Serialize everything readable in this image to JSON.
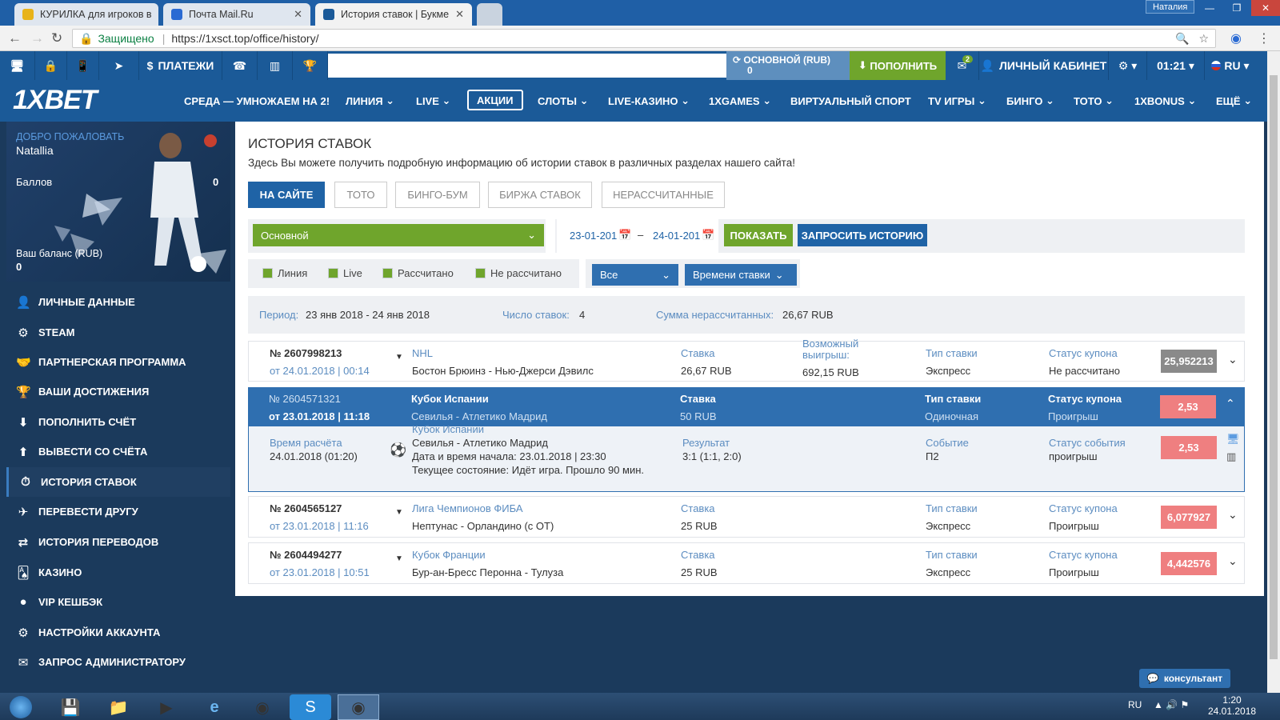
{
  "browser": {
    "tabs": [
      {
        "title": "КУРИЛКА для игроков в",
        "fav": "#e8b31a"
      },
      {
        "title": "Почта Mail.Ru",
        "fav": "#2a6ad3"
      },
      {
        "title": "История ставок | Букме",
        "fav": "#1b5a98"
      }
    ],
    "user": "Наталия",
    "secure_label": "Защищено",
    "url": "https://1xsct.top/office/history/"
  },
  "topbar": {
    "payments": "ПЛАТЕЖИ",
    "balance_label": "ОСНОВНОЙ (RUB)",
    "balance_value": "0",
    "deposit": "ПОПОЛНИТЬ",
    "messages_badge": "2",
    "cabinet": "ЛИЧНЫЙ КАБИНЕТ",
    "time": "01:21",
    "lang": "RU"
  },
  "logo": "1XBET",
  "nav": [
    "СРЕДА — УМНОЖАЕМ НА 2!",
    "ЛИНИЯ",
    "LIVE",
    "АКЦИИ",
    "СЛОТЫ",
    "LIVE-КАЗИНО",
    "1XGAMES",
    "ВИРТУАЛЬНЫЙ СПОРТ",
    "TV ИГРЫ",
    "БИНГО",
    "ТОТО",
    "1XBONUS",
    "ЕЩЁ"
  ],
  "profile": {
    "welcome": "ДОБРО ПОЖАЛОВАТЬ",
    "name": "Natallia",
    "points_label": "Баллов",
    "points": "0",
    "balance_label": "Ваш баланс (RUB)",
    "balance": "0"
  },
  "sidebar": [
    {
      "label": "ЛИЧНЫЕ ДАННЫЕ",
      "icon": "user-icon"
    },
    {
      "label": "STEAM",
      "icon": "steam-icon"
    },
    {
      "label": "ПАРТНЕРСКАЯ ПРОГРАММА",
      "icon": "handshake-icon"
    },
    {
      "label": "ВАШИ ДОСТИЖЕНИЯ",
      "icon": "trophy-icon"
    },
    {
      "label": "ПОПОЛНИТЬ СЧЁТ",
      "icon": "download-icon"
    },
    {
      "label": "ВЫВЕСТИ СО СЧЁТА",
      "icon": "upload-icon"
    },
    {
      "label": "ИСТОРИЯ СТАВОК",
      "icon": "history-icon"
    },
    {
      "label": "ПЕРЕВЕСТИ ДРУГУ",
      "icon": "transfer-icon"
    },
    {
      "label": "ИСТОРИЯ ПЕРЕВОДОВ",
      "icon": "arrows-icon"
    },
    {
      "label": "КАЗИНО",
      "icon": "cards-icon"
    },
    {
      "label": "VIP КЕШБЭК",
      "icon": "dot-icon"
    },
    {
      "label": "НАСТРОЙКИ АККАУНТА",
      "icon": "gears-icon"
    },
    {
      "label": "ЗАПРОС АДМИНИСТРАТОРУ",
      "icon": "mail-icon"
    }
  ],
  "page": {
    "title": "ИСТОРИЯ СТАВОК",
    "subtitle": "Здесь Вы можете получить подробную информацию об истории ставок в различных разделах нашего сайта!",
    "tabs": [
      "НА САЙТЕ",
      "ТОТО",
      "БИНГО-БУМ",
      "БИРЖА СТАВОК",
      "НЕРАССЧИТАННЫЕ"
    ],
    "account_select": "Основной",
    "date_from": "23-01-201",
    "date_dash": "–",
    "date_to": "24-01-201",
    "show": "ПОКАЗАТЬ",
    "request": "ЗАПРОСИТЬ ИСТОРИЮ",
    "checks": [
      "Линия",
      "Live",
      "Рассчитано",
      "Не рассчитано"
    ],
    "filter_all": "Все",
    "filter_time": "Времени ставки",
    "summary": {
      "period_label": "Период:",
      "period": "23 янв 2018 - 24 янв 2018",
      "count_label": "Число ставок:",
      "count": "4",
      "unsettled_label": "Сумма нерассчитанных:",
      "unsettled": "26,67 RUB"
    }
  },
  "bets": [
    {
      "id": "№ 2607998213",
      "date": "от 24.01.2018 | 00:14",
      "league": "NHL",
      "match": "Бостон Брюинз - Нью-Джерси Дэвилс",
      "stake_label": "Ставка",
      "stake": "26,67 RUB",
      "win_label": "Возможный выигрыш:",
      "win": "692,15 RUB",
      "type_label": "Тип ставки",
      "type": "Экспресс",
      "status_label": "Статус купона",
      "status": "Не рассчитано",
      "odd": "25,952213",
      "odd_color": "#8a8a8a"
    },
    {
      "id": "№ 2604571321",
      "date": "от 23.01.2018 | 11:18",
      "league": "Кубок Испании",
      "match": "Севилья - Атлетико Мадрид",
      "stake_label": "Ставка",
      "stake": "50 RUB",
      "type_label": "Тип ставки",
      "type": "Одиночная",
      "status_label": "Статус купона",
      "status": "Проигрыш",
      "odd": "2,53",
      "odd_color": "#ef7f80"
    },
    {
      "id": "№ 2604565127",
      "date": "от 23.01.2018 | 11:16",
      "league": "Лига Чемпионов ФИБА",
      "match": "Нептунас - Орландино (с ОТ)",
      "stake_label": "Ставка",
      "stake": "25 RUB",
      "type_label": "Тип ставки",
      "type": "Экспресс",
      "status_label": "Статус купона",
      "status": "Проигрыш",
      "odd": "6,077927",
      "odd_color": "#ef7f80"
    },
    {
      "id": "№ 2604494277",
      "date": "от 23.01.2018 | 10:51",
      "league": "Кубок Франции",
      "match": "Бур-ан-Бресс Перонна - Тулуза",
      "stake_label": "Ставка",
      "stake": "25 RUB",
      "type_label": "Тип ставки",
      "type": "Экспресс",
      "status_label": "Статус купона",
      "status": "Проигрыш",
      "odd": "4,442576",
      "odd_color": "#ef7f80"
    }
  ],
  "detail": {
    "calc_label": "Время расчёта",
    "calc": "24.01.2018 (01:20)",
    "league": "Кубок Испании",
    "match": "Севилья - Атлетико Мадрид",
    "start": "Дата и время начала: 23.01.2018 | 23:30",
    "state": "Текущее состояние: Идёт игра. Прошло 90 мин.",
    "result_label": "Результат",
    "result": "3:1 (1:1, 2:0)",
    "event_label": "Событие",
    "event": "П2",
    "event_status_label": "Статус события",
    "event_status": "проигрыш",
    "odd": "2,53"
  },
  "consultant": "консультант",
  "taskbar": {
    "lang": "RU",
    "time": "1:20",
    "date": "24.01.2018"
  }
}
